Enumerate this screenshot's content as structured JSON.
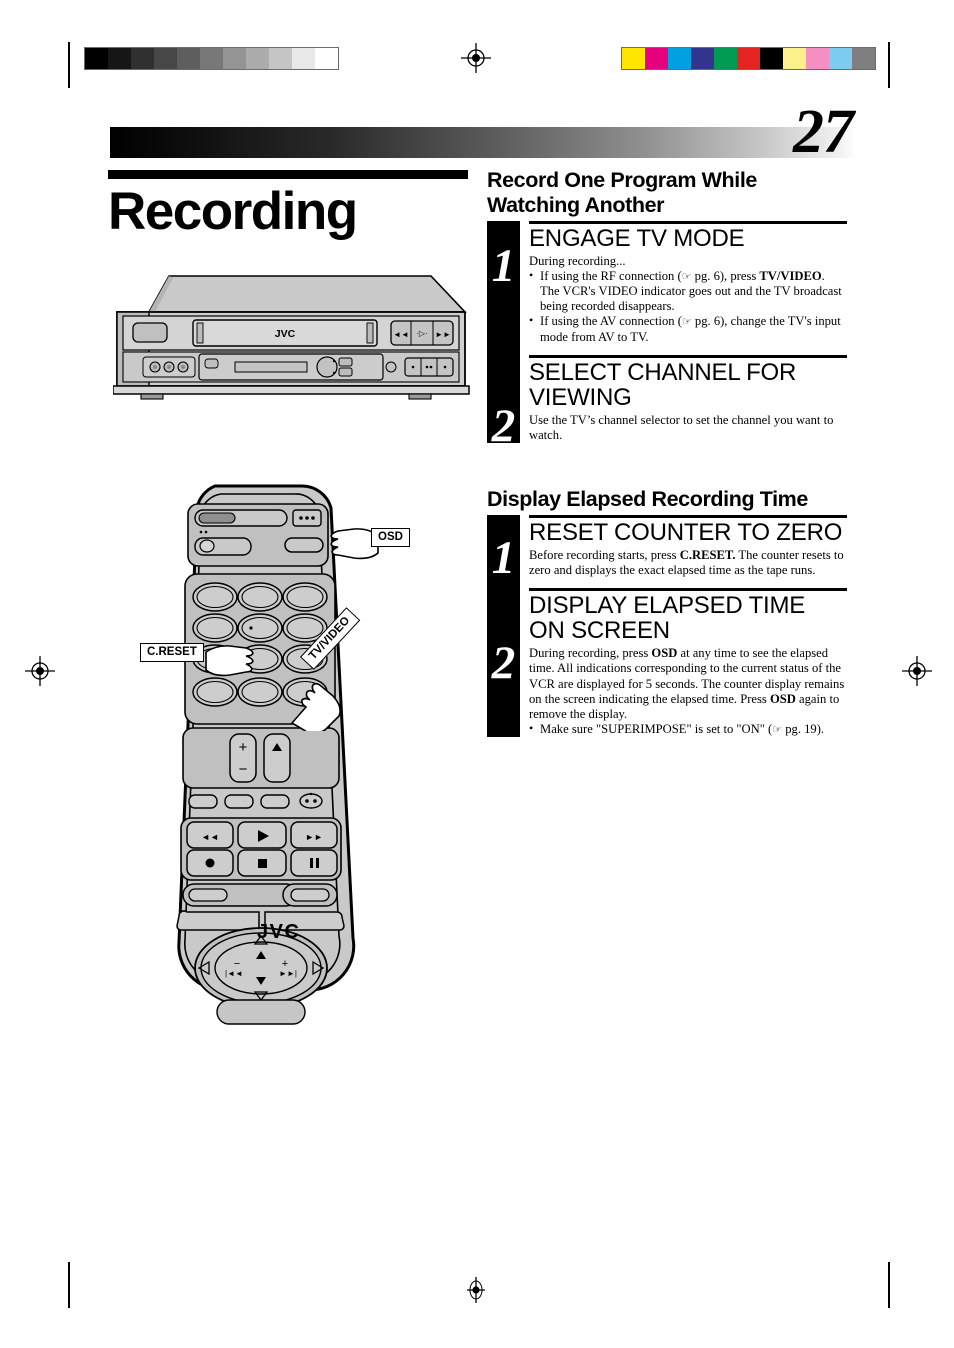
{
  "page": {
    "folio": "27",
    "chapter_title": "Recording"
  },
  "printer_marks": {
    "grayscale_wedge": [
      "#000000",
      "#161616",
      "#303030",
      "#474747",
      "#5e5e5e",
      "#787878",
      "#949494",
      "#ababab",
      "#c5c5c5",
      "#e8e8e8",
      "#ffffff"
    ],
    "color_wedge": [
      "#ffe400",
      "#e6007e",
      "#00a0e1",
      "#33348e",
      "#009a54",
      "#e52421",
      "#000000",
      "#fbf08a",
      "#f58fc2",
      "#7ecdf0",
      "#7f7f7f"
    ]
  },
  "device": {
    "vcr_brand": "JVC",
    "remote_brand": "JVC"
  },
  "callouts": {
    "osd": "OSD",
    "creset": "C.RESET",
    "tvvideo": "TV/VIDEO"
  },
  "sections": [
    {
      "title": "Record One Program While Watching Another",
      "steps": [
        {
          "number": "1",
          "head": "ENGAGE TV MODE",
          "intro": "During recording...",
          "bullets": [
            "If using the RF connection (☞ pg. 6), press TV/VIDEO. The VCR's VIDEO indicator goes out and the TV broadcast being recorded disappears.",
            "If using the AV connection (☞ pg. 6), change the TV's input mode from AV to TV."
          ]
        },
        {
          "number": "2",
          "head": "SELECT CHANNEL FOR VIEWING",
          "body": "Use the TV’s channel selector to set the channel you want to watch."
        }
      ]
    },
    {
      "title": "Display Elapsed Recording Time",
      "steps": [
        {
          "number": "1",
          "head": "RESET COUNTER TO ZERO",
          "body": "Before recording starts, press C.RESET. The counter resets to zero and displays the exact elapsed time as the tape runs."
        },
        {
          "number": "2",
          "head": "DISPLAY ELAPSED TIME ON SCREEN",
          "body": "During recording, press OSD at any time to see the elapsed time. All indications corresponding to the current status of the VCR are displayed for 5 seconds. The counter display remains on the screen indicating the elapsed time. Press OSD again to remove the display.",
          "bullets": [
            "Make sure \"SUPERIMPOSE\" is set to \"ON\" (☞ pg. 19)."
          ]
        }
      ]
    }
  ],
  "step_text": {
    "s1_intro": "During recording...",
    "s1_b1_a": "If using the RF connection (",
    "s1_b1_ref": "☞",
    "s1_b1_b": " pg. 6), press ",
    "s1_b1_bold": "TV/VIDEO",
    "s1_b1_c": ". The VCR's VIDEO indicator goes out and the TV broadcast being recorded disappears.",
    "s1_b2_a": "If using the AV connection (",
    "s1_b2_b": " pg. 6), change the TV's input mode from AV to TV.",
    "s2_body": "Use the TV’s channel selector to set the channel you want to watch.",
    "s3_a": "Before recording starts, press ",
    "s3_bold": "C.RESET.",
    "s3_b": " The counter resets to zero and displays the exact elapsed time as the tape runs.",
    "s4_a": "During recording, press ",
    "s4_bold1": "OSD",
    "s4_b": " at any time to see the elapsed time. All indications corresponding to the current status of the VCR are displayed for 5 seconds. The counter display remains on the screen indicating the elapsed time. Press ",
    "s4_bold2": "OSD",
    "s4_c": " again to remove the display.",
    "s4_bullet_a": "Make sure \"SUPERIMPOSE\" is set to \"ON\" (",
    "s4_bullet_b": " pg. 19)."
  },
  "headings": {
    "sec1": "Record One Program While Watching Another",
    "sec2": "Display Elapsed Recording Time",
    "h1": "ENGAGE TV MODE",
    "h2": "SELECT CHANNEL FOR VIEWING",
    "h3": "RESET COUNTER TO ZERO",
    "h4": "DISPLAY ELAPSED TIME ON SCREEN",
    "n1": "1",
    "n2": "2",
    "n3": "1",
    "n4": "2"
  }
}
